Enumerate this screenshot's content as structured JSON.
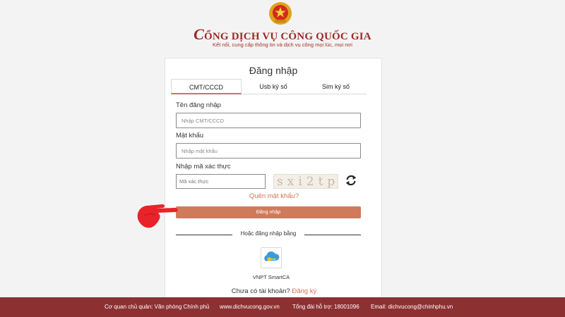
{
  "header": {
    "emblem_icon": "national-emblem-icon",
    "title_initial": "C",
    "title_rest": "ỔNG DỊCH VỤ CÔNG QUỐC GIA",
    "tagline": "Kết nối, cung cấp thông tin và dịch vụ công mọi lúc, mọi nơi"
  },
  "login": {
    "title": "Đăng nhập",
    "tabs": [
      {
        "label": "CMT/CCCD",
        "active": true
      },
      {
        "label": "Usb ký số",
        "active": false
      },
      {
        "label": "Sim ký số",
        "active": false
      }
    ],
    "username": {
      "label": "Tên đăng nhập",
      "placeholder": "Nhập CMT/CCCD",
      "value": ""
    },
    "password": {
      "label": "Mật khẩu",
      "placeholder": "Nhập mật khẩu",
      "value": ""
    },
    "captcha": {
      "label": "Nhập mã xác thực",
      "placeholder": "Mã xác thực",
      "value": "",
      "image_text": "sxi2tp"
    },
    "forgot_label": "Quên mật khẩu?",
    "submit_label": "Đăng nhập",
    "alt_login_label": "Hoặc đăng nhập bằng",
    "smartca": {
      "label": "VNPT SmartCA",
      "icon": "vnpt-smartca-icon"
    },
    "signup_prompt": "Chưa có tài khoản?",
    "signup_link": "Đăng ký"
  },
  "footer": {
    "agency": "Cơ quan chủ quản: Văn phòng Chính phủ",
    "website": "www.dichvucong.gov.vn",
    "hotline": "Tổng đài hỗ trợ: 18001096",
    "email": "Email: dichvucong@chinhphu.vn"
  },
  "colors": {
    "brand": "#9c2a25",
    "accent": "#cf7a5b",
    "footer_bg": "#8d3032",
    "pointer_hand": "#e8232a"
  }
}
